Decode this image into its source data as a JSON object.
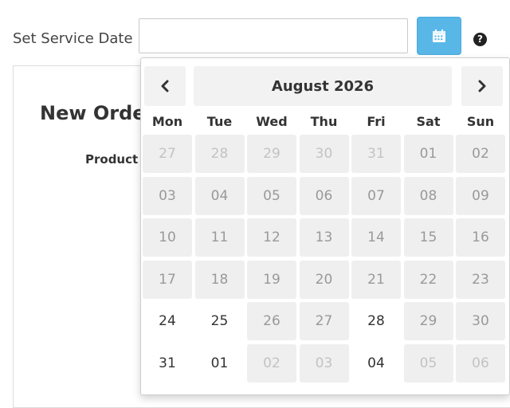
{
  "form": {
    "service_date_label": "Set Service Date",
    "service_date_value": "",
    "calendar_button_icon": "calendar-icon",
    "help_icon_glyph": "?"
  },
  "panel": {
    "title": "New Orde",
    "column_label": "Product"
  },
  "datepicker": {
    "month_label": "August 2026",
    "prev_glyph": "‹",
    "next_glyph": "›",
    "weekdays": [
      "Mon",
      "Tue",
      "Wed",
      "Thu",
      "Fri",
      "Sat",
      "Sun"
    ],
    "weeks": [
      [
        {
          "d": "27",
          "state": "other-disabled"
        },
        {
          "d": "28",
          "state": "other-disabled"
        },
        {
          "d": "29",
          "state": "other-disabled"
        },
        {
          "d": "30",
          "state": "other-disabled"
        },
        {
          "d": "31",
          "state": "other-disabled"
        },
        {
          "d": "01",
          "state": "disabled"
        },
        {
          "d": "02",
          "state": "disabled"
        }
      ],
      [
        {
          "d": "03",
          "state": "disabled"
        },
        {
          "d": "04",
          "state": "disabled"
        },
        {
          "d": "05",
          "state": "disabled"
        },
        {
          "d": "06",
          "state": "disabled"
        },
        {
          "d": "07",
          "state": "disabled"
        },
        {
          "d": "08",
          "state": "disabled"
        },
        {
          "d": "09",
          "state": "disabled"
        }
      ],
      [
        {
          "d": "10",
          "state": "disabled"
        },
        {
          "d": "11",
          "state": "disabled"
        },
        {
          "d": "12",
          "state": "disabled"
        },
        {
          "d": "13",
          "state": "disabled"
        },
        {
          "d": "14",
          "state": "disabled"
        },
        {
          "d": "15",
          "state": "disabled"
        },
        {
          "d": "16",
          "state": "disabled"
        }
      ],
      [
        {
          "d": "17",
          "state": "disabled"
        },
        {
          "d": "18",
          "state": "disabled"
        },
        {
          "d": "19",
          "state": "disabled"
        },
        {
          "d": "20",
          "state": "disabled"
        },
        {
          "d": "21",
          "state": "disabled"
        },
        {
          "d": "22",
          "state": "disabled"
        },
        {
          "d": "23",
          "state": "disabled"
        }
      ],
      [
        {
          "d": "24",
          "state": "enabled"
        },
        {
          "d": "25",
          "state": "enabled"
        },
        {
          "d": "26",
          "state": "disabled"
        },
        {
          "d": "27",
          "state": "disabled"
        },
        {
          "d": "28",
          "state": "enabled"
        },
        {
          "d": "29",
          "state": "disabled"
        },
        {
          "d": "30",
          "state": "disabled"
        }
      ],
      [
        {
          "d": "31",
          "state": "enabled"
        },
        {
          "d": "01",
          "state": "other-enabled"
        },
        {
          "d": "02",
          "state": "other-disabled"
        },
        {
          "d": "03",
          "state": "other-disabled"
        },
        {
          "d": "04",
          "state": "other-enabled"
        },
        {
          "d": "05",
          "state": "other-disabled"
        },
        {
          "d": "06",
          "state": "other-disabled"
        }
      ]
    ]
  },
  "colors": {
    "accent": "#59b7e8",
    "disabled_cell_bg": "#efefef",
    "enabled_text": "#333333"
  }
}
